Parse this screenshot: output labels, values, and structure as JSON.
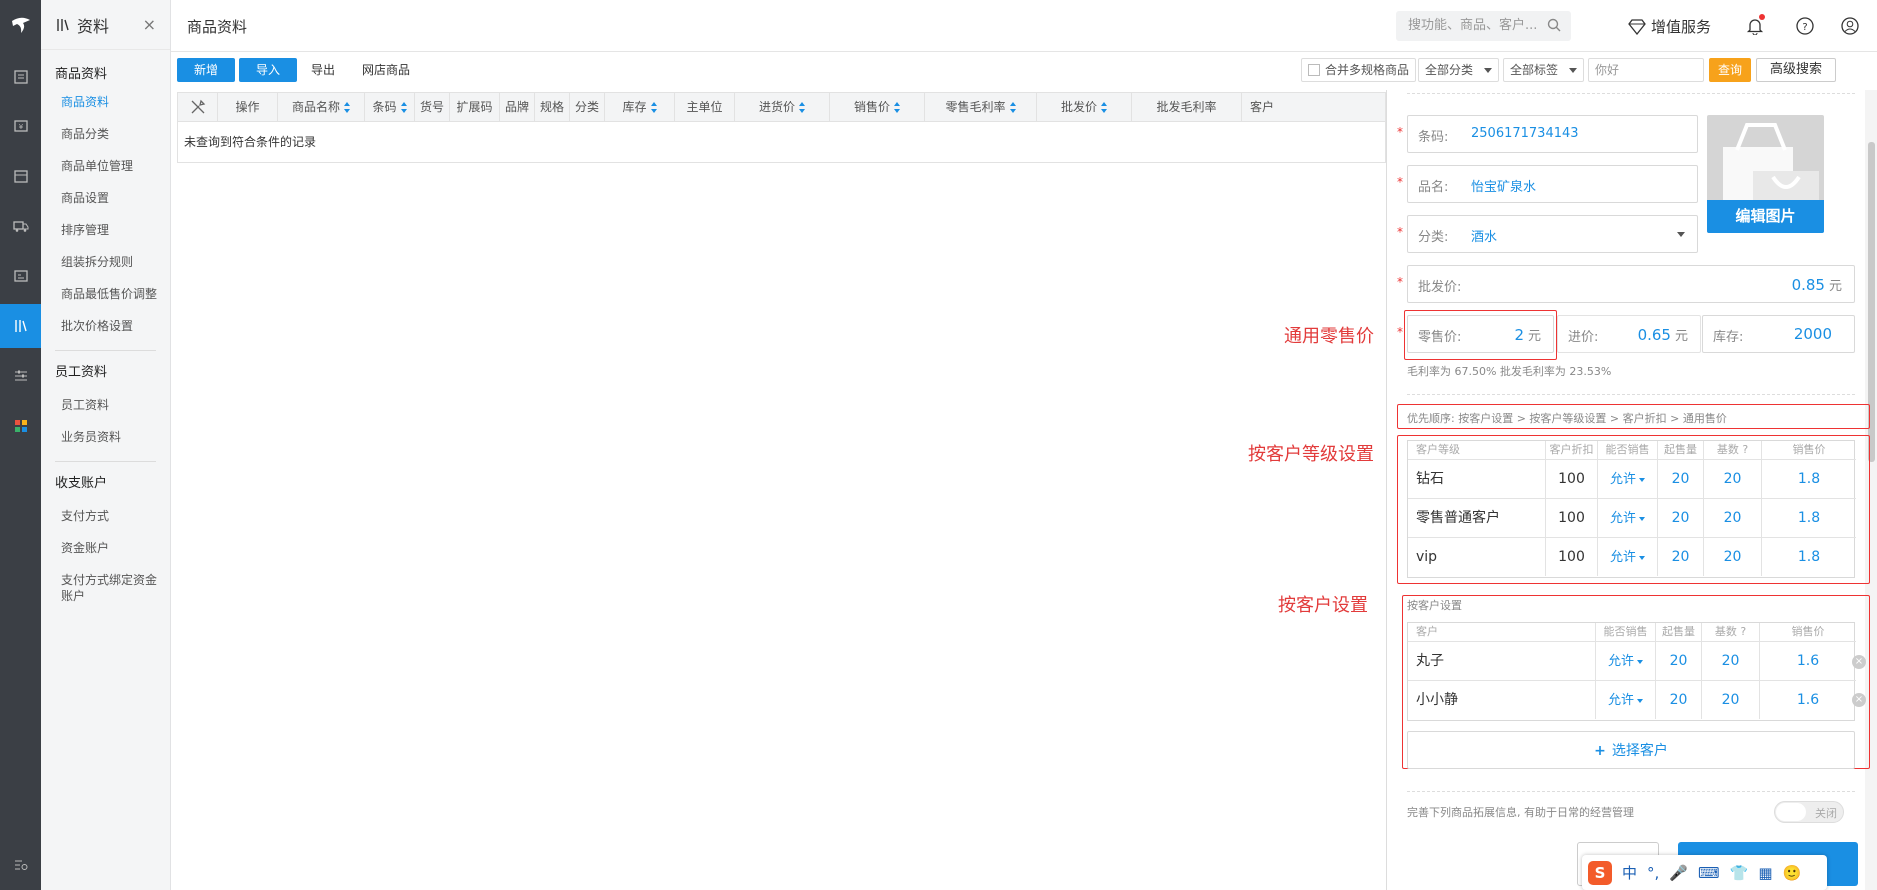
{
  "app": {
    "logo": "ޏ"
  },
  "rail": {
    "icons": [
      "book-icon",
      "money-icon",
      "box-icon",
      "truck-icon",
      "report-icon",
      "archive-icon",
      "sliders-icon",
      "apps-icon",
      "search-menu-icon"
    ]
  },
  "sidebar": {
    "title": "资料",
    "close": "×",
    "groups": [
      {
        "label": "商品资料",
        "items": [
          "商品资料",
          "商品分类",
          "商品单位管理",
          "商品设置",
          "排序管理",
          "组装拆分规则",
          "商品最低售价调整",
          "批次价格设置"
        ]
      },
      {
        "label": "员工资料",
        "items": [
          "员工资料",
          "业务员资料"
        ]
      },
      {
        "label": "收支账户",
        "items": [
          "支付方式",
          "资金账户",
          "支付方式绑定资金账户"
        ]
      }
    ]
  },
  "header": {
    "title": "商品资料",
    "search_placeholder": "搜功能、商品、客户...",
    "value_added": "增值服务"
  },
  "toolbar": {
    "new": "新增",
    "import": "导入",
    "export": "导出",
    "online_goods": "网店商品",
    "merge_spec": "合并多规格商品",
    "category": "全部分类",
    "tags": "全部标签",
    "keyword": "你好",
    "query": "查询",
    "advanced": "高级搜索"
  },
  "grid": {
    "columns": [
      "操作",
      "商品名称",
      "条码",
      "货号",
      "扩展码",
      "品牌",
      "规格",
      "分类",
      "库存",
      "主单位",
      "进货价",
      "销售价",
      "零售毛利率",
      "批发价",
      "批发毛利率",
      "客户"
    ],
    "empty_text": "未查询到符合条件的记录"
  },
  "form": {
    "barcode_label": "条码:",
    "barcode": "2506171734143",
    "name_label": "品名:",
    "name": "怡宝矿泉水",
    "category_label": "分类:",
    "category": "酒水",
    "edit_image": "编辑图片",
    "wholesale_label": "批发价:",
    "wholesale": "0.85",
    "unit": "元",
    "retail_label": "零售价:",
    "retail": "2",
    "purchase_label": "进价:",
    "purchase": "0.65",
    "stock_label": "库存:",
    "stock": "2000",
    "margin_note": "毛利率为 67.50% 批发毛利率为 23.53%",
    "priority_note": "优先顺序:  按客户设置 > 按客户等级设置 > 客户折扣 > 通用售价",
    "level_table": {
      "headers": [
        "客户等级",
        "客户折扣",
        "能否销售",
        "起售量",
        "基数 ?",
        "销售价"
      ],
      "rows": [
        [
          "钻石",
          "100",
          "允许",
          "20",
          "20",
          "1.8"
        ],
        [
          "零售普通客户",
          "100",
          "允许",
          "20",
          "20",
          "1.8"
        ],
        [
          "vip",
          "100",
          "允许",
          "20",
          "20",
          "1.8"
        ]
      ]
    },
    "customer_section_title": "按客户设置",
    "customer_table": {
      "headers": [
        "客户",
        "能否销售",
        "起售量",
        "基数 ?",
        "销售价"
      ],
      "rows": [
        [
          "丸子",
          "允许",
          "20",
          "20",
          "1.6"
        ],
        [
          "小小静",
          "允许",
          "20",
          "20",
          "1.6"
        ]
      ]
    },
    "select_customer": "选择客户",
    "extend_note": "完善下列商品拓展信息, 有助于日常的经营管理",
    "toggle_label": "关闭"
  },
  "annotations": {
    "retail": "通用零售价",
    "level": "按客户等级设置",
    "customer": "按客户设置"
  },
  "ime": {
    "logo": "S",
    "items": [
      "中",
      "°,",
      "🎤",
      "⌨",
      "👕",
      "▦",
      "🙂"
    ]
  }
}
